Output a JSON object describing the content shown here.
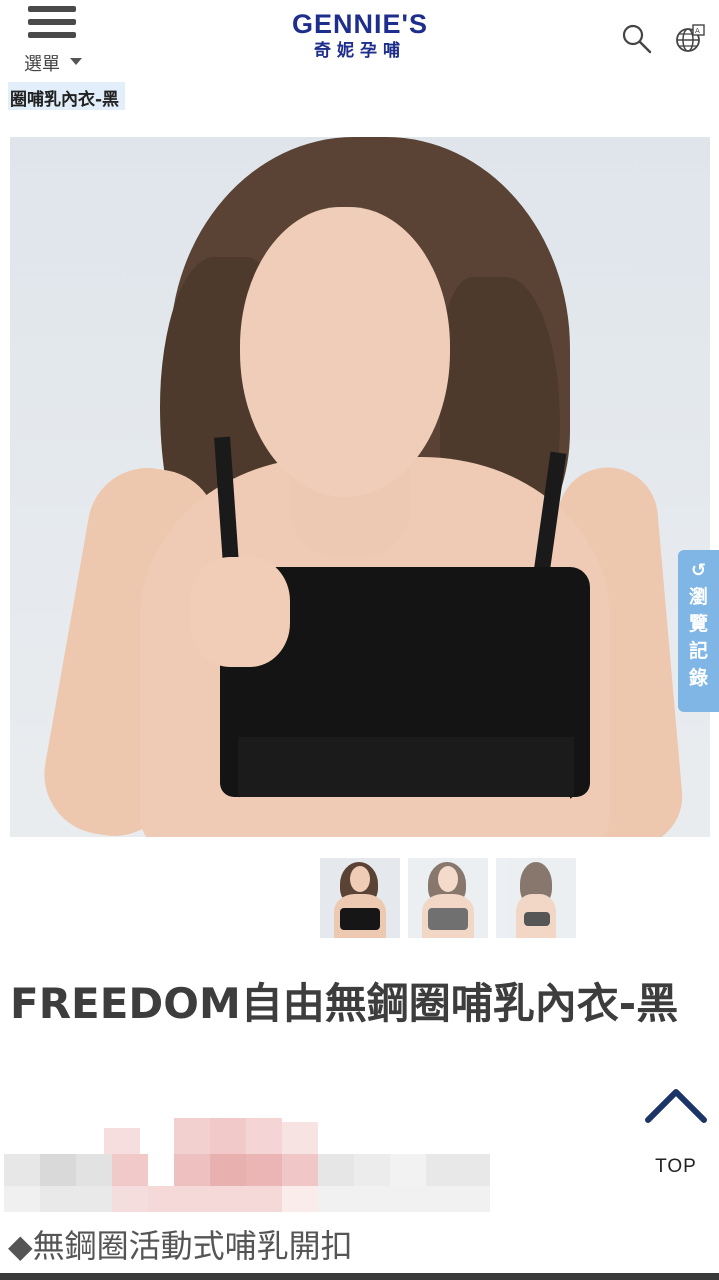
{
  "header": {
    "menu_label": "選單",
    "logo_en": "GENNIE'S",
    "logo_zh": "奇妮孕哺"
  },
  "breadcrumb": {
    "label": "圈哺乳內衣-黑"
  },
  "history_tab": {
    "icon": "↺",
    "label": "瀏覽記錄"
  },
  "thumbnails": [
    {
      "name": "front-view"
    },
    {
      "name": "front-view-alt"
    },
    {
      "name": "back-view"
    }
  ],
  "product": {
    "title": "FREEDOM自由無鋼圈哺乳內衣-黑",
    "feature": "◆無鋼圈活動式哺乳開扣"
  },
  "back_to_top": {
    "label": "TOP"
  },
  "colors": {
    "brand": "#1e2e8c",
    "history_tab": "#7fb6e6",
    "breadcrumb_bg": "#e2eef9",
    "top_arrow": "#1b3566"
  },
  "icons": {
    "menu": "hamburger-icon",
    "search": "search-icon",
    "language": "globe-icon",
    "history": "history-icon",
    "top": "chevron-up-icon"
  }
}
